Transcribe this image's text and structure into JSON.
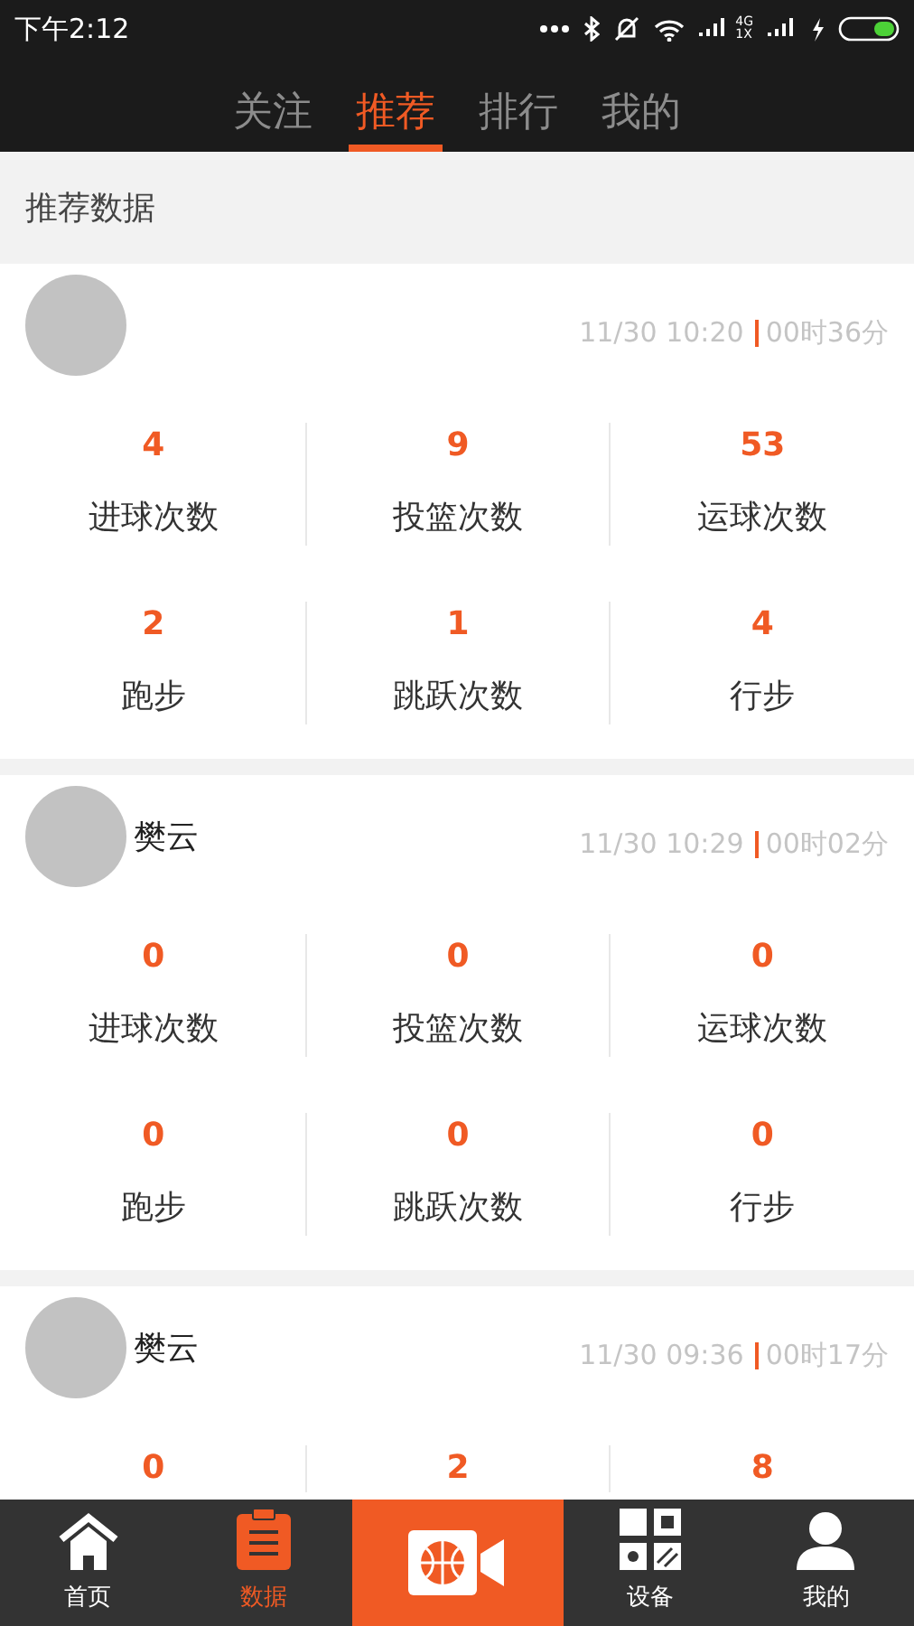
{
  "status_bar": {
    "time": "下午2:12",
    "network_label": "4G",
    "network_sub": "1X"
  },
  "tabs": [
    {
      "label": "关注",
      "selected": false
    },
    {
      "label": "推荐",
      "selected": true
    },
    {
      "label": "排行",
      "selected": false
    },
    {
      "label": "我的",
      "selected": false
    }
  ],
  "section_title": "推荐数据",
  "records": [
    {
      "time": "11/30 10:20",
      "duration": "00时36分",
      "stats": [
        {
          "value": "4",
          "label": "进球次数"
        },
        {
          "value": "9",
          "label": "投篮次数"
        },
        {
          "value": "53",
          "label": "运球次数"
        },
        {
          "value": "2",
          "label": "跑步"
        },
        {
          "value": "1",
          "label": "跳跃次数"
        },
        {
          "value": "4",
          "label": "行步"
        }
      ]
    },
    {
      "name": "樊云",
      "time": "11/30 10:29",
      "duration": "00时02分",
      "stats": [
        {
          "value": "0",
          "label": "进球次数"
        },
        {
          "value": "0",
          "label": "投篮次数"
        },
        {
          "value": "0",
          "label": "运球次数"
        },
        {
          "value": "0",
          "label": "跑步"
        },
        {
          "value": "0",
          "label": "跳跃次数"
        },
        {
          "value": "0",
          "label": "行步"
        }
      ]
    },
    {
      "name": "樊云",
      "time": "11/30 09:36",
      "duration": "00时17分",
      "stats": [
        {
          "value": "0"
        },
        {
          "value": "2"
        },
        {
          "value": "8"
        }
      ]
    }
  ],
  "bottom_nav": [
    {
      "kind": "home",
      "label": "首页",
      "selected": false
    },
    {
      "kind": "clipboard",
      "label": "数据",
      "selected": true
    },
    {
      "kind": "camera"
    },
    {
      "kind": "devices",
      "label": "设备",
      "selected": false
    },
    {
      "kind": "user",
      "label": "我的",
      "selected": false
    }
  ]
}
